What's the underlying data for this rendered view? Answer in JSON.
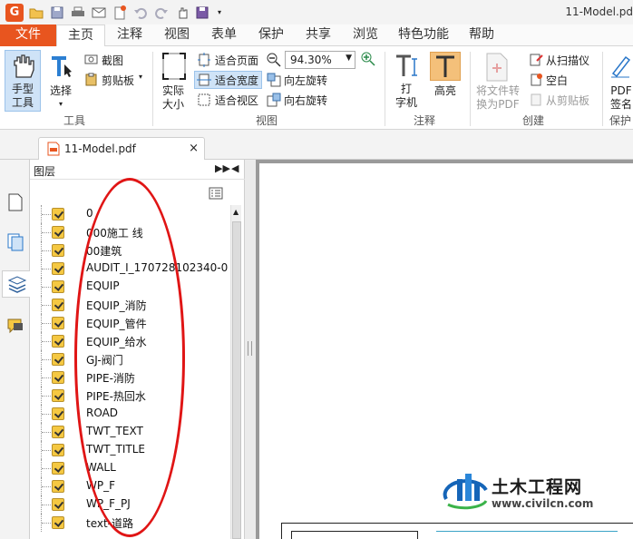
{
  "window": {
    "title": "11-Model.pd"
  },
  "quick_access": {
    "logo_glyph": "G"
  },
  "tabs": [
    {
      "label": "文件"
    },
    {
      "label": "主页"
    },
    {
      "label": "注释"
    },
    {
      "label": "视图"
    },
    {
      "label": "表单"
    },
    {
      "label": "保护"
    },
    {
      "label": "共享"
    },
    {
      "label": "浏览"
    },
    {
      "label": "特色功能"
    },
    {
      "label": "帮助"
    }
  ],
  "ribbon": {
    "hand_tool": "手型\n工具",
    "select": "选择",
    "snapshot": "截图",
    "clipboard": "剪贴板",
    "group_tools": "工具",
    "actual_size": "实际\n大小",
    "fit_page": "适合页面",
    "fit_width": "适合宽度",
    "fit_visible": "适合视区",
    "zoom_value": "94.30%",
    "rotate_left": "向左旋转",
    "rotate_right": "向右旋转",
    "group_view": "视图",
    "typewriter": "打\n字机",
    "highlight": "高亮",
    "group_annotate": "注释",
    "file_to_pdf": "将文件转\n换为PDF",
    "from_scanner": "从扫描仪",
    "blank": "空白",
    "from_clipboard": "从剪贴板",
    "group_create": "创建",
    "pdf_sign": "PDF\n签名",
    "group_protect": "保护"
  },
  "doc_tab": {
    "name": "11-Model.pdf",
    "close": "×"
  },
  "layers_panel": {
    "title": "图层",
    "items": [
      "0",
      "000施工 线",
      "00建筑",
      "AUDIT_I_170728102340-0",
      "EQUIP",
      "EQUIP_消防",
      "EQUIP_管件",
      "EQUIP_给水",
      "GJ-阀门",
      "PIPE-消防",
      "PIPE-热回水",
      "ROAD",
      "TWT_TEXT",
      "TWT_TITLE",
      "WALL",
      "WP_F",
      "WP_F_PJ",
      "text-道路"
    ]
  },
  "watermark": {
    "name": "土木工程网",
    "url": "www.civilcn.com"
  },
  "colors": {
    "accent": "#e8551f",
    "highlight_bg": "#cfe3f7",
    "checkbox": "#f5c842",
    "annotation_red": "#e01515"
  }
}
